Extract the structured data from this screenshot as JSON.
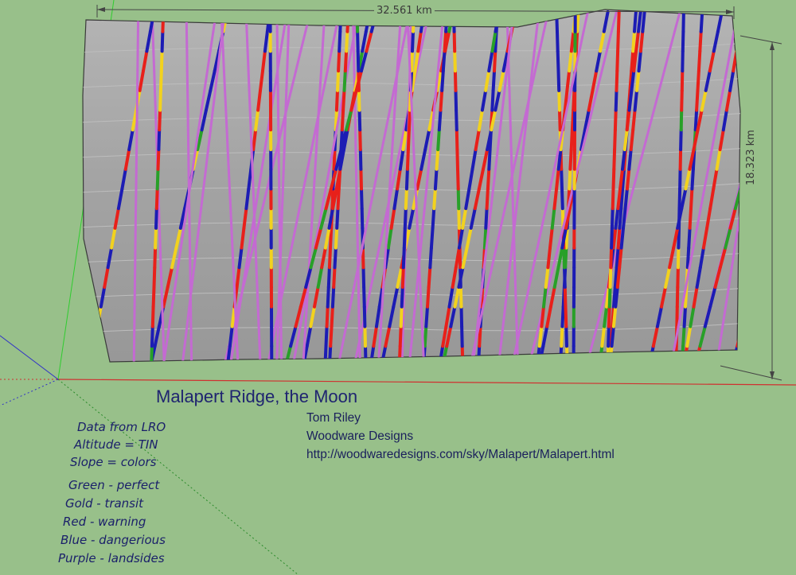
{
  "dimensions": {
    "width_label": "32.561 km",
    "height_label": "18.323 km"
  },
  "title": "Malapert Ridge, the Moon",
  "credits": [
    "Tom Riley",
    "Woodware Designs",
    "http://woodwaredesigns.com/sky/Malapert/Malapert.html"
  ],
  "info": [
    "Data from LRO",
    "Altitude = TIN",
    "Slope = colors"
  ],
  "legend": [
    {
      "text": "Green - perfect",
      "color": "#28a028"
    },
    {
      "text": "Gold - transit",
      "color": "#f2d21e"
    },
    {
      "text": "Red - warning",
      "color": "#e8201a"
    },
    {
      "text": "Blue - dangerious",
      "color": "#1c1cb4"
    },
    {
      "text": "Purple - landsides",
      "color": "#c46ad2"
    }
  ],
  "colors": {
    "background": "#98c08a",
    "terrain": "#a6a6a6",
    "text": "#1f2470"
  }
}
